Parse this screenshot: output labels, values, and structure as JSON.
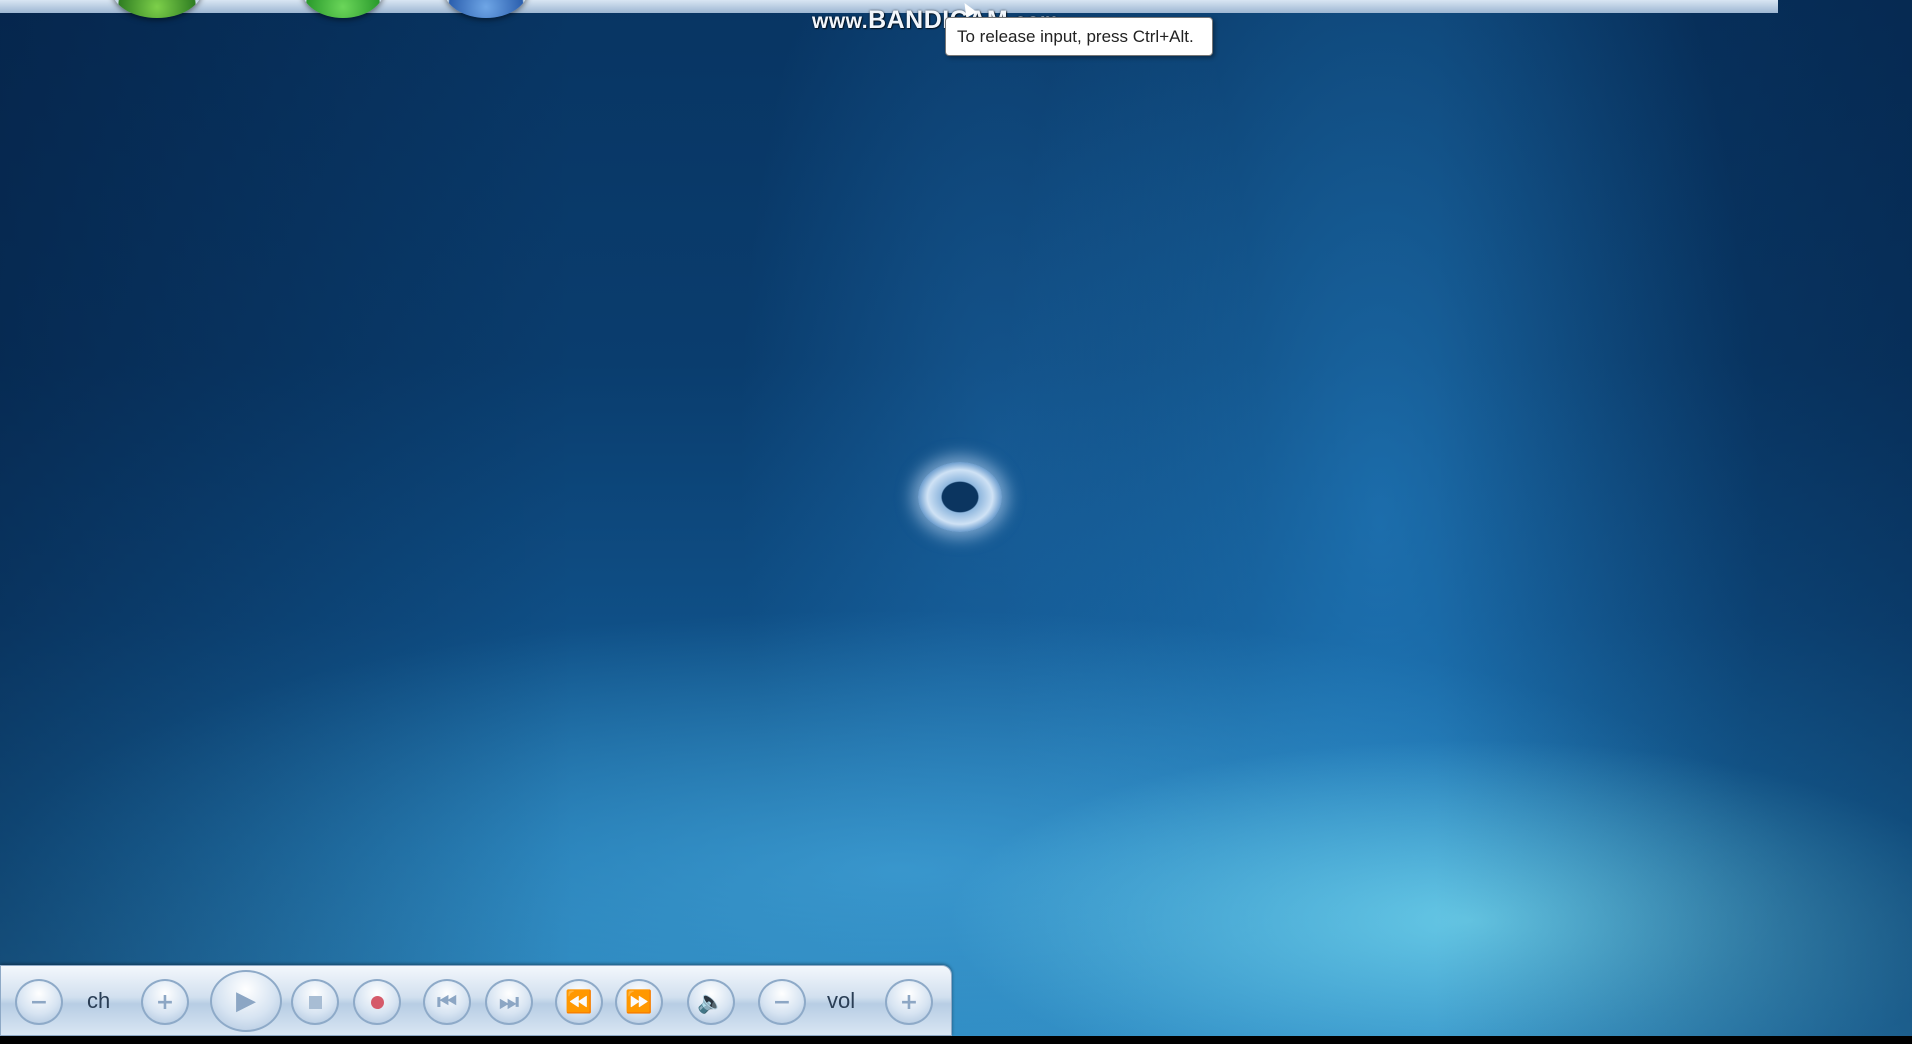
{
  "screen": {
    "watermark": {
      "prefix": "www.",
      "brand": "BANDICAM",
      "suffix": ".com"
    },
    "tooltip": {
      "text": "To release input, press Ctrl+Alt."
    },
    "top_buttons": [
      {
        "name": "start-orb",
        "icon": "windows-flag-icon"
      },
      {
        "name": "back-orb",
        "icon": "back-arrow-icon"
      },
      {
        "name": "help-orb",
        "icon": "help-icon"
      }
    ],
    "loader": {
      "icon": "loading-spinner-icon"
    }
  },
  "transport": {
    "ch_label": "ch",
    "vol_label": "vol",
    "buttons": {
      "ch_minus": "−",
      "ch_plus": "+",
      "play": "▶",
      "stop": "",
      "record": "",
      "prev": "⏮",
      "next": "⏭",
      "rewind": "⏪",
      "fast_forward": "⏩",
      "mute": "🔈",
      "vol_minus": "−",
      "vol_plus": "+"
    },
    "colors": {
      "record": "#d55a6a",
      "bar_light": "#f3f7fc",
      "bar_dark": "#b7cde4"
    }
  }
}
